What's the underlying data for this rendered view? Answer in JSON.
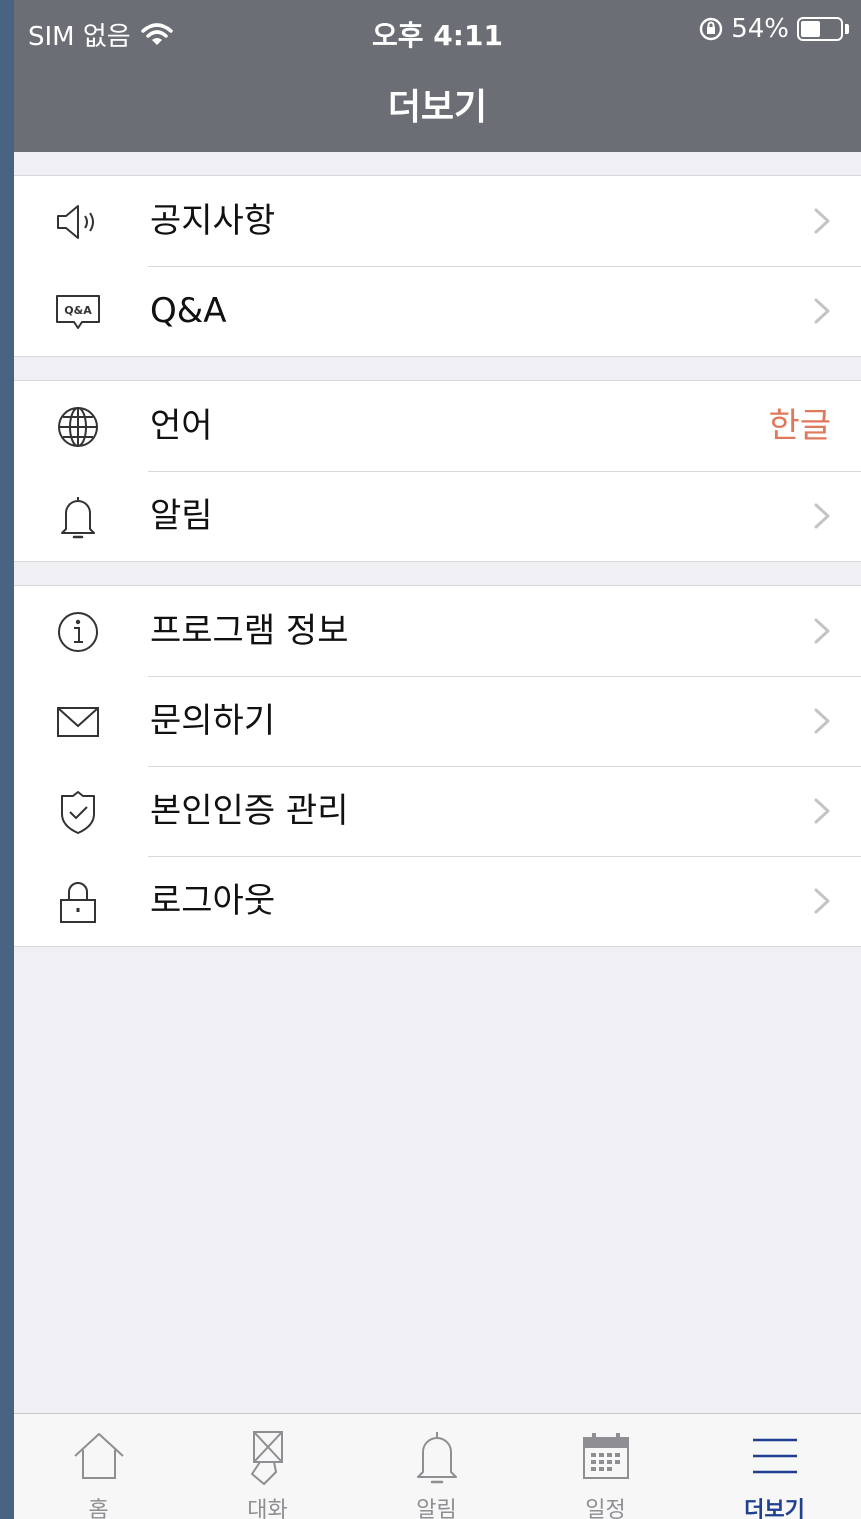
{
  "status_bar": {
    "carrier": "SIM 없음",
    "time": "오후 4:11",
    "battery": "54%",
    "battery_level": 0.54
  },
  "nav": {
    "title": "더보기"
  },
  "groups": [
    {
      "rows": [
        {
          "label": "공지사항",
          "icon": "speaker-icon"
        },
        {
          "label": "Q&A",
          "icon": "qa-bubble-icon",
          "icon_text": "Q&A"
        }
      ]
    },
    {
      "rows": [
        {
          "label": "언어",
          "icon": "globe-icon",
          "value": "한글",
          "value_color": "#e0795c"
        },
        {
          "label": "알림",
          "icon": "bell-icon"
        }
      ]
    },
    {
      "rows": [
        {
          "label": "프로그램 정보",
          "icon": "info-icon"
        },
        {
          "label": "문의하기",
          "icon": "envelope-icon"
        },
        {
          "label": "본인인증 관리",
          "icon": "shield-check-icon"
        },
        {
          "label": "로그아웃",
          "icon": "lock-icon"
        }
      ]
    }
  ],
  "tabbar": {
    "active_color": "#1f3f8f",
    "tabs": [
      {
        "label": "홈",
        "icon": "home-icon"
      },
      {
        "label": "대화",
        "icon": "chat-envelope-icon"
      },
      {
        "label": "알림",
        "icon": "bell-icon"
      },
      {
        "label": "일정",
        "icon": "calendar-icon"
      },
      {
        "label": "더보기",
        "icon": "menu-icon",
        "active": true
      }
    ]
  }
}
